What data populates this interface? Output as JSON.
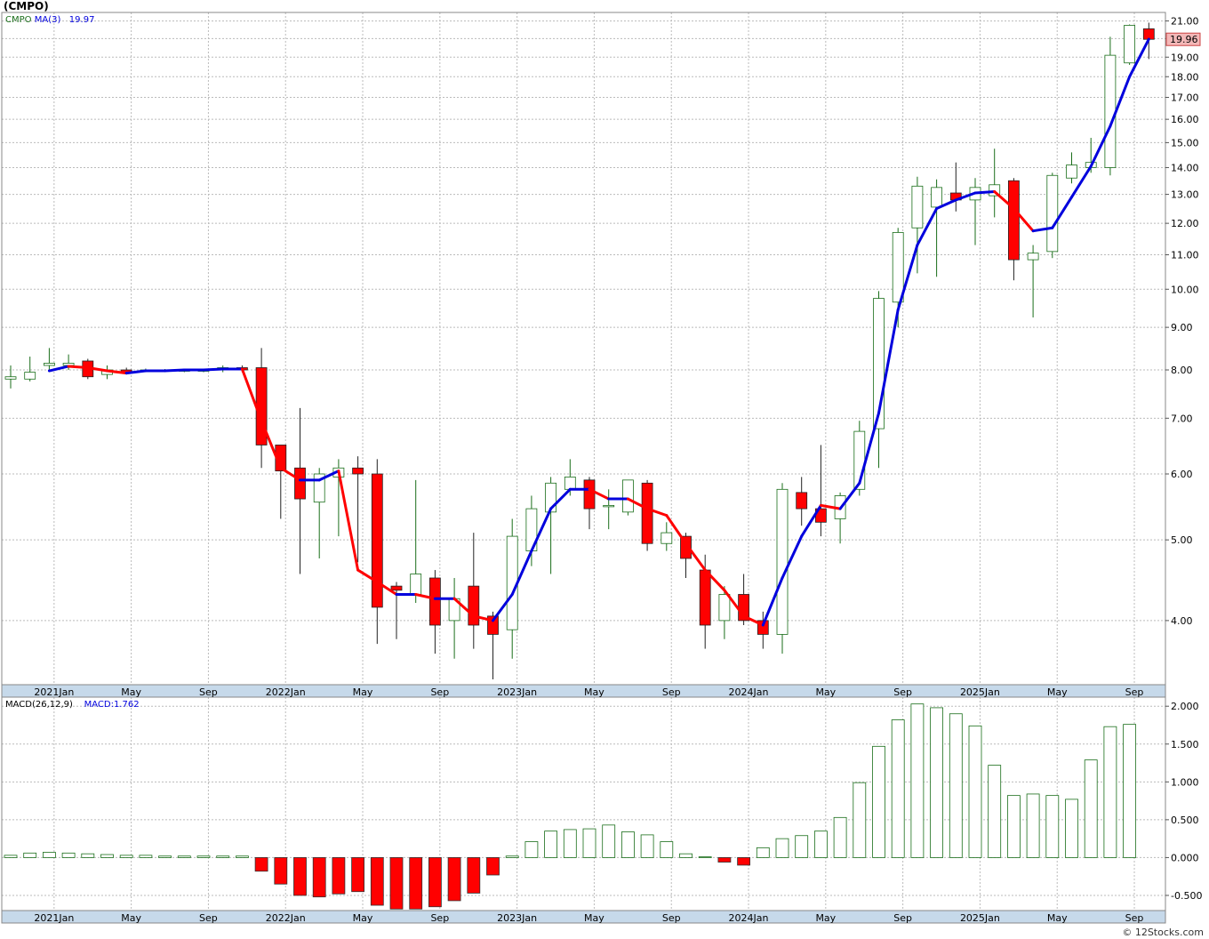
{
  "title": "(CMPO)",
  "credit": "© 12Stocks.com",
  "colors": {
    "up": "#1a6e1a",
    "down": "#ff0000",
    "ma_rising": "#0000dd",
    "ma_falling": "#ff0000",
    "grid": "#bbbbbb",
    "axis_bar": "#c6d9ea",
    "last_price_bg": "#f4b8b8"
  },
  "chart_data": [
    {
      "type": "candlestick",
      "legend": [
        {
          "text": "CMPO",
          "color": "#1a6e1a"
        },
        {
          "text": "MA(3)",
          "color": "#0000dd"
        },
        {
          "text": "19.97",
          "color": "#0000dd"
        }
      ],
      "last_price_label": "19.96",
      "y_scale": "log",
      "ylim": [
        3.35,
        21.5
      ],
      "y_ticks": [
        {
          "v": 21,
          "label": "21.00"
        },
        {
          "v": 20,
          "label": "20.00"
        },
        {
          "v": 19,
          "label": "19.00"
        },
        {
          "v": 18,
          "label": "18.00"
        },
        {
          "v": 17,
          "label": "17.00"
        },
        {
          "v": 16,
          "label": "16.00"
        },
        {
          "v": 15,
          "label": "15.00"
        },
        {
          "v": 14,
          "label": "14.00"
        },
        {
          "v": 13,
          "label": "13.00"
        },
        {
          "v": 12,
          "label": "12.00"
        },
        {
          "v": 11,
          "label": "11.00"
        },
        {
          "v": 10,
          "label": "10.00"
        },
        {
          "v": 9,
          "label": "9.00"
        },
        {
          "v": 8,
          "label": "8.00"
        },
        {
          "v": 7,
          "label": "7.00"
        },
        {
          "v": 6,
          "label": "6.00"
        },
        {
          "v": 5,
          "label": "5.00"
        },
        {
          "v": 4,
          "label": "4.00"
        }
      ],
      "x_ticks": [
        {
          "i": 2.25,
          "label": "2021Jan"
        },
        {
          "i": 6.25,
          "label": "May"
        },
        {
          "i": 10.25,
          "label": "Sep"
        },
        {
          "i": 14.25,
          "label": "2022Jan"
        },
        {
          "i": 18.25,
          "label": "May"
        },
        {
          "i": 22.25,
          "label": "Sep"
        },
        {
          "i": 26.25,
          "label": "2023Jan"
        },
        {
          "i": 30.25,
          "label": "May"
        },
        {
          "i": 34.25,
          "label": "Sep"
        },
        {
          "i": 38.25,
          "label": "2024Jan"
        },
        {
          "i": 42.25,
          "label": "May"
        },
        {
          "i": 46.25,
          "label": "Sep"
        },
        {
          "i": 50.25,
          "label": "2025Jan"
        },
        {
          "i": 54.25,
          "label": "May"
        },
        {
          "i": 58.25,
          "label": "Sep"
        }
      ],
      "candles": [
        {
          "o": 7.8,
          "h": 8.1,
          "l": 7.6,
          "c": 7.85
        },
        {
          "o": 7.8,
          "h": 8.3,
          "l": 7.75,
          "c": 7.95
        },
        {
          "o": 8.1,
          "h": 8.5,
          "l": 8.0,
          "c": 8.15
        },
        {
          "o": 8.1,
          "h": 8.35,
          "l": 8.0,
          "c": 8.15
        },
        {
          "o": 8.2,
          "h": 8.25,
          "l": 7.8,
          "c": 7.85
        },
        {
          "o": 7.9,
          "h": 8.1,
          "l": 7.8,
          "c": 8.0
        },
        {
          "o": 8.0,
          "h": 8.05,
          "l": 7.9,
          "c": 7.95
        },
        {
          "o": 7.98,
          "h": 8.03,
          "l": 7.95,
          "c": 8.0
        },
        {
          "o": 7.98,
          "h": 8.02,
          "l": 7.95,
          "c": 8.0
        },
        {
          "o": 7.98,
          "h": 8.02,
          "l": 7.95,
          "c": 8.0
        },
        {
          "o": 7.98,
          "h": 8.02,
          "l": 7.95,
          "c": 8.0
        },
        {
          "o": 8.0,
          "h": 8.1,
          "l": 7.95,
          "c": 8.05
        },
        {
          "o": 8.05,
          "h": 8.1,
          "l": 7.95,
          "c": 8.0
        },
        {
          "o": 8.05,
          "h": 8.5,
          "l": 6.1,
          "c": 6.5
        },
        {
          "o": 6.5,
          "h": 6.5,
          "l": 5.3,
          "c": 6.05
        },
        {
          "o": 6.1,
          "h": 7.2,
          "l": 4.55,
          "c": 5.6
        },
        {
          "o": 5.55,
          "h": 6.1,
          "l": 4.75,
          "c": 6.0
        },
        {
          "o": 5.95,
          "h": 6.25,
          "l": 5.05,
          "c": 6.1
        },
        {
          "o": 6.1,
          "h": 6.3,
          "l": 4.7,
          "c": 6.0
        },
        {
          "o": 6.0,
          "h": 6.25,
          "l": 3.75,
          "c": 4.15
        },
        {
          "o": 4.4,
          "h": 4.45,
          "l": 3.8,
          "c": 4.35
        },
        {
          "o": 4.3,
          "h": 5.9,
          "l": 4.2,
          "c": 4.55
        },
        {
          "o": 4.5,
          "h": 4.6,
          "l": 3.65,
          "c": 3.95
        },
        {
          "o": 4.0,
          "h": 4.5,
          "l": 3.6,
          "c": 4.25
        },
        {
          "o": 4.4,
          "h": 5.1,
          "l": 3.7,
          "c": 3.95
        },
        {
          "o": 4.05,
          "h": 4.1,
          "l": 3.4,
          "c": 3.85
        },
        {
          "o": 3.9,
          "h": 5.3,
          "l": 3.6,
          "c": 5.05
        },
        {
          "o": 4.85,
          "h": 5.65,
          "l": 4.65,
          "c": 5.45
        },
        {
          "o": 5.4,
          "h": 5.95,
          "l": 4.55,
          "c": 5.85
        },
        {
          "o": 5.75,
          "h": 6.25,
          "l": 5.65,
          "c": 5.95
        },
        {
          "o": 5.9,
          "h": 5.95,
          "l": 5.15,
          "c": 5.45
        },
        {
          "o": 5.5,
          "h": 5.75,
          "l": 5.15,
          "c": 5.5
        },
        {
          "o": 5.4,
          "h": 5.9,
          "l": 5.35,
          "c": 5.9
        },
        {
          "o": 5.85,
          "h": 5.9,
          "l": 4.85,
          "c": 4.95
        },
        {
          "o": 4.95,
          "h": 5.25,
          "l": 4.85,
          "c": 5.1
        },
        {
          "o": 5.05,
          "h": 5.1,
          "l": 4.5,
          "c": 4.75
        },
        {
          "o": 4.6,
          "h": 4.8,
          "l": 3.7,
          "c": 3.95
        },
        {
          "o": 4.0,
          "h": 4.4,
          "l": 3.8,
          "c": 4.3
        },
        {
          "o": 4.3,
          "h": 4.55,
          "l": 3.95,
          "c": 4.0
        },
        {
          "o": 4.0,
          "h": 4.1,
          "l": 3.7,
          "c": 3.85
        },
        {
          "o": 3.85,
          "h": 5.85,
          "l": 3.65,
          "c": 5.75
        },
        {
          "o": 5.7,
          "h": 5.95,
          "l": 5.2,
          "c": 5.45
        },
        {
          "o": 5.45,
          "h": 6.5,
          "l": 5.05,
          "c": 5.25
        },
        {
          "o": 5.3,
          "h": 5.7,
          "l": 4.95,
          "c": 5.65
        },
        {
          "o": 5.75,
          "h": 6.95,
          "l": 5.65,
          "c": 6.75
        },
        {
          "o": 6.8,
          "h": 9.95,
          "l": 6.1,
          "c": 9.75
        },
        {
          "o": 9.65,
          "h": 11.85,
          "l": 9.0,
          "c": 11.7
        },
        {
          "o": 11.85,
          "h": 13.65,
          "l": 10.45,
          "c": 13.3
        },
        {
          "o": 12.55,
          "h": 13.55,
          "l": 10.35,
          "c": 13.25
        },
        {
          "o": 13.05,
          "h": 14.2,
          "l": 12.4,
          "c": 12.8
        },
        {
          "o": 12.8,
          "h": 13.6,
          "l": 11.3,
          "c": 13.25
        },
        {
          "o": 12.95,
          "h": 14.75,
          "l": 12.2,
          "c": 13.35
        },
        {
          "o": 13.5,
          "h": 13.6,
          "l": 10.25,
          "c": 10.85
        },
        {
          "o": 10.85,
          "h": 11.3,
          "l": 9.25,
          "c": 11.05
        },
        {
          "o": 11.1,
          "h": 13.8,
          "l": 10.9,
          "c": 13.7
        },
        {
          "o": 13.6,
          "h": 14.6,
          "l": 13.4,
          "c": 14.1
        },
        {
          "o": 14.0,
          "h": 15.2,
          "l": 13.8,
          "c": 14.2
        },
        {
          "o": 14.0,
          "h": 20.1,
          "l": 13.7,
          "c": 19.1
        },
        {
          "o": 18.7,
          "h": 20.8,
          "l": 18.6,
          "c": 20.75
        },
        {
          "o": 20.55,
          "h": 20.9,
          "l": 18.9,
          "c": 19.96
        }
      ],
      "ma3": [
        null,
        null,
        7.98,
        8.08,
        8.05,
        7.98,
        7.93,
        7.98,
        7.98,
        8.0,
        8.0,
        8.02,
        8.02,
        6.95,
        6.1,
        5.9,
        5.9,
        6.05,
        4.6,
        4.45,
        4.3,
        4.3,
        4.25,
        4.25,
        4.05,
        4.0,
        4.3,
        4.85,
        5.45,
        5.75,
        5.75,
        5.6,
        5.6,
        5.45,
        5.35,
        4.95,
        4.6,
        4.35,
        4.05,
        3.95,
        4.5,
        5.05,
        5.5,
        5.45,
        5.85,
        7.1,
        9.45,
        11.3,
        12.5,
        12.8,
        13.05,
        13.1,
        12.5,
        11.75,
        11.85,
        12.9,
        14.05,
        15.7,
        18.0,
        19.97
      ]
    },
    {
      "type": "bar",
      "legend": [
        {
          "text": "MACD(26,12,9)",
          "color": "#000000"
        },
        {
          "text": "MACD:1.762",
          "color": "#0000dd"
        }
      ],
      "ylim": [
        -0.7,
        2.12
      ],
      "y_ticks": [
        {
          "v": 2.0,
          "label": "2.000"
        },
        {
          "v": 1.5,
          "label": "1.500"
        },
        {
          "v": 1.0,
          "label": "1.000"
        },
        {
          "v": 0.5,
          "label": "0.500"
        },
        {
          "v": 0.0,
          "label": "0.000"
        },
        {
          "v": -0.5,
          "label": "-0.500"
        }
      ],
      "values": [
        0.03,
        0.06,
        0.07,
        0.06,
        0.05,
        0.04,
        0.03,
        0.03,
        0.02,
        0.02,
        0.02,
        0.02,
        0.02,
        -0.18,
        -0.35,
        -0.5,
        -0.52,
        -0.48,
        -0.45,
        -0.63,
        -0.68,
        -0.68,
        -0.65,
        -0.57,
        -0.47,
        -0.23,
        0.02,
        0.21,
        0.35,
        0.37,
        0.38,
        0.43,
        0.34,
        0.3,
        0.21,
        0.05,
        0.01,
        -0.06,
        -0.1,
        0.13,
        0.25,
        0.29,
        0.35,
        0.53,
        0.99,
        1.47,
        1.82,
        2.03,
        1.98,
        1.9,
        1.74,
        1.22,
        0.82,
        0.84,
        0.82,
        0.77,
        1.29,
        1.73,
        1.76
      ]
    }
  ]
}
